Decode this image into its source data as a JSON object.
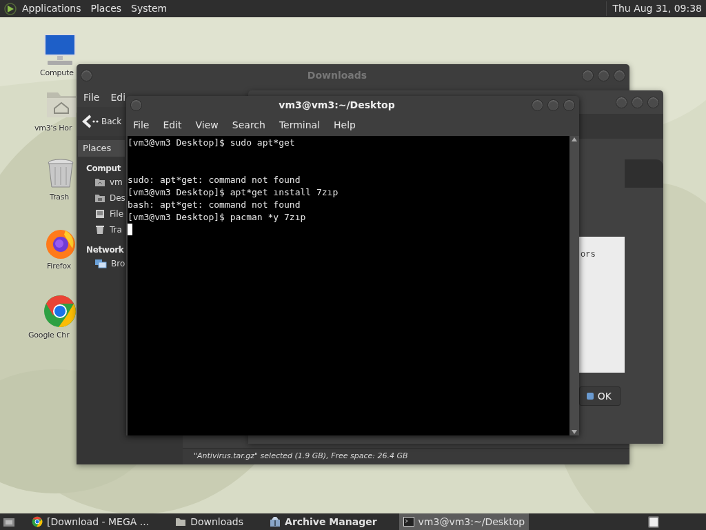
{
  "top_panel": {
    "menus": [
      "Applications",
      "Places",
      "System"
    ],
    "clock": "Thu Aug 31, 09:38"
  },
  "desktop_icons": [
    {
      "kind": "computer",
      "label": "Compute"
    },
    {
      "kind": "home",
      "label": "vm3's Hor"
    },
    {
      "kind": "trash",
      "label": "Trash"
    },
    {
      "kind": "firefox",
      "label": "Firefox"
    },
    {
      "kind": "chrome",
      "label": "Google Chr"
    }
  ],
  "file_manager": {
    "title": "Downloads",
    "menus": [
      "File",
      "Edi"
    ],
    "back_label": "Back",
    "side_tab": "Places",
    "sidebar": [
      {
        "heading": "Comput",
        "items": [
          {
            "kind": "home",
            "label": "vm"
          },
          {
            "kind": "desktop",
            "label": "Des"
          },
          {
            "kind": "filesystem",
            "label": "File"
          },
          {
            "kind": "trash",
            "label": "Tra"
          }
        ]
      },
      {
        "heading": "Network",
        "items": [
          {
            "kind": "network",
            "label": "Bro"
          }
        ]
      }
    ],
    "status": "\"Antivirus.tar.gz\" selected (1.9 GB), Free space: 26.4 GB"
  },
  "archive_manager": {
    "text": "ors",
    "button": "OK"
  },
  "terminal": {
    "title": "vm3@vm3:~/Desktop",
    "menus": [
      "File",
      "Edit",
      "View",
      "Search",
      "Terminal",
      "Help"
    ],
    "lines": [
      {
        "text": "[vm3@vm3 Desktop]$ sudo apt*get",
        "spaced": false
      },
      {
        "text": "sudo: apt*get: command not found",
        "spaced": true
      },
      {
        "text": "[vm3@vm3 Desktop]$ apt*get ınstall 7zıp",
        "spaced": false
      },
      {
        "text": "bash: apt*get: command not found",
        "spaced": false
      },
      {
        "text": "[vm3@vm3 Desktop]$ pacman *y 7zıp",
        "spaced": false
      }
    ],
    "cursor": true
  },
  "taskbar": {
    "items": [
      {
        "kind": "chrome",
        "label": "[Download - MEGA ...",
        "selected": false,
        "bold": false
      },
      {
        "kind": "folder",
        "label": "Downloads",
        "selected": false,
        "bold": false
      },
      {
        "kind": "archive",
        "label": "Archive Manager",
        "selected": false,
        "bold": true
      },
      {
        "kind": "terminal",
        "label": "vm3@vm3:~/Desktop",
        "selected": true,
        "bold": false
      }
    ]
  }
}
